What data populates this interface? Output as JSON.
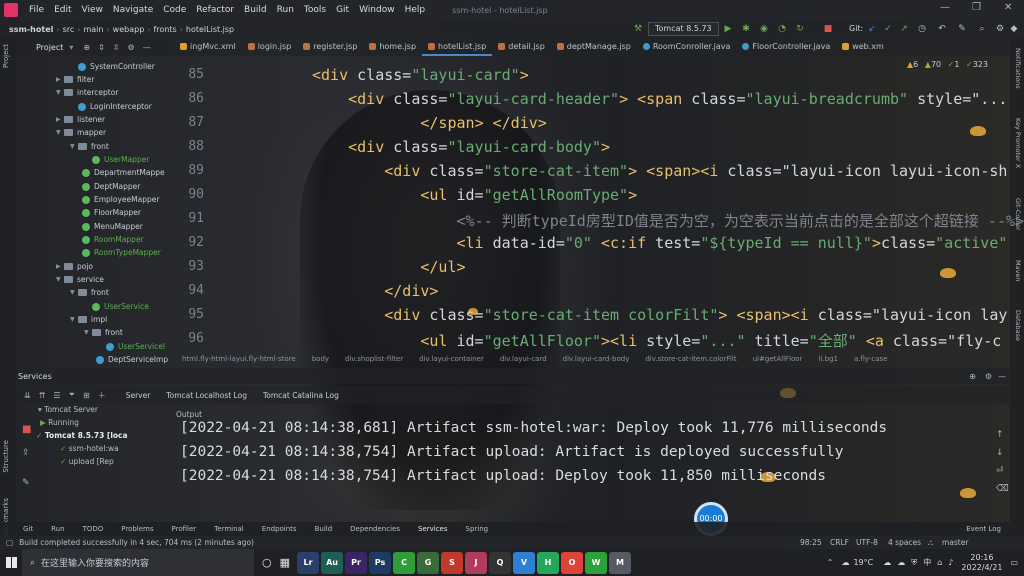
{
  "menubar": {
    "items": [
      "File",
      "Edit",
      "View",
      "Navigate",
      "Code",
      "Refactor",
      "Build",
      "Run",
      "Tools",
      "Git",
      "Window",
      "Help"
    ],
    "window_title": "ssm-hotel - hotelList.jsp"
  },
  "breadcrumb": [
    "ssm-hotel",
    "src",
    "main",
    "webapp",
    "fronts",
    "hotelList.jsp"
  ],
  "run_config": "Tomcat 8.5.73",
  "git_label": "Git:",
  "project_panel": {
    "title": "Project",
    "tree": [
      {
        "label": "SystemController",
        "kind": "class"
      },
      {
        "label": "filter",
        "kind": "folder"
      },
      {
        "label": "interceptor",
        "kind": "folder"
      },
      {
        "label": "LoginInterceptor",
        "kind": "class"
      },
      {
        "label": "listener",
        "kind": "folder"
      },
      {
        "label": "mapper",
        "kind": "folder"
      },
      {
        "label": "front",
        "kind": "folder"
      },
      {
        "label": "UserMapper",
        "kind": "iface-green"
      },
      {
        "label": "DepartmentMappe",
        "kind": "iface"
      },
      {
        "label": "DeptMapper",
        "kind": "iface"
      },
      {
        "label": "EmployeeMapper",
        "kind": "iface"
      },
      {
        "label": "FloorMapper",
        "kind": "iface"
      },
      {
        "label": "MenuMapper",
        "kind": "iface"
      },
      {
        "label": "RoomMapper",
        "kind": "iface-green"
      },
      {
        "label": "RoomTypeMapper",
        "kind": "iface-green"
      },
      {
        "label": "pojo",
        "kind": "folder"
      },
      {
        "label": "service",
        "kind": "folder"
      },
      {
        "label": "front",
        "kind": "folder"
      },
      {
        "label": "UserService",
        "kind": "iface-green"
      },
      {
        "label": "impl",
        "kind": "folder"
      },
      {
        "label": "front",
        "kind": "folder"
      },
      {
        "label": "UserServiceI",
        "kind": "class-green"
      },
      {
        "label": "DeptServiceImp",
        "kind": "class"
      }
    ]
  },
  "tabs": [
    {
      "label": "ingMvc.xml",
      "color": "#e0a030"
    },
    {
      "label": "login.jsp",
      "color": "#c07040"
    },
    {
      "label": "register.jsp",
      "color": "#c07040"
    },
    {
      "label": "home.jsp",
      "color": "#c07040"
    },
    {
      "label": "hotelList.jsp",
      "color": "#c07040"
    },
    {
      "label": "detail.jsp",
      "color": "#c07040"
    },
    {
      "label": "deptManage.jsp",
      "color": "#c07040"
    },
    {
      "label": "RoomConroller.java",
      "color": "#3e9cd1"
    },
    {
      "label": "FloorController.java",
      "color": "#3e9cd1"
    },
    {
      "label": "web.xm",
      "color": "#e0a030"
    }
  ],
  "inspections": {
    "warnings": "6",
    "weak": "70",
    "typos": "1",
    "other": "323"
  },
  "editor": {
    "line_numbers": [
      "85",
      "86",
      "87",
      "88",
      "89",
      "90",
      "91",
      "92",
      "93",
      "94",
      "95",
      "96"
    ],
    "lines": [
      "<div class=\"layui-card\">",
      "    <div class=\"layui-card-header\"> <span class=\"layui-breadcrumb\" style=\"...",
      "            </span> </div>",
      "    <div class=\"layui-card-body\">",
      "        <div class=\"store-cat-item\"> <span><i class=\"layui-icon layui-icon-sh",
      "            <ul id=\"getAllRoomType\">",
      "                <%-- 判断typeId房型ID值是否为空，为空表示当前点击的是全部这个超链接 --%>",
      "                <li data-id=\"0\" <c:if test=\"${typeId == null}\">class=\"active\"",
      "            </ul>",
      "        </div>",
      "        <div class=\"store-cat-item colorFilt\"> <span><i class=\"layui-icon lay",
      "            <ul id=\"getAllFloor\"><li style=\"...\" title=\"全部\" <a class=\"fly-c"
    ]
  },
  "html_crumbs": [
    "html.fly-html-layui.fly-html-store",
    "body",
    "div.shoplist-filter",
    "div.layui-container",
    "div.layui-card",
    "div.layui-card-body",
    "div.store-cat-item.colorFilt",
    "ul#getAllFloor",
    "li.bg1",
    "a.fly-case"
  ],
  "services": {
    "title": "Services",
    "tabs": [
      "Server",
      "Tomcat Localhost Log",
      "Tomcat Catalina Log"
    ],
    "output_label": "Output",
    "tree": [
      {
        "label": "Tomcat Server"
      },
      {
        "label": "Running"
      },
      {
        "label": "Tomcat 8.5.73 [loca"
      },
      {
        "label": "ssm-hotel:wa"
      },
      {
        "label": "upload [Rep"
      }
    ],
    "log": [
      "[2022-04-21 08:14:38,681] Artifact ssm-hotel:war: Deploy took 11,776 milliseconds",
      "[2022-04-21 08:14:38,754] Artifact upload: Artifact is deployed successfully",
      "[2022-04-21 08:14:38,754] Artifact upload: Deploy took 11,850 milliseconds"
    ]
  },
  "timer": "00:00",
  "toolwindows": [
    "Git",
    "Run",
    "TODO",
    "Problems",
    "Profiler",
    "Terminal",
    "Endpoints",
    "Build",
    "Dependencies",
    "Services",
    "Spring"
  ],
  "event_log": "Event Log",
  "status": {
    "message": "Build completed successfully in 4 sec, 704 ms (2 minutes ago)",
    "position": "98:25",
    "line_sep": "CRLF",
    "encoding": "UTF-8",
    "indent": "4 spaces",
    "branch": "master"
  },
  "taskbar": {
    "search_placeholder": "在这里输入你要搜索的内容",
    "apps": [
      {
        "label": "Lr",
        "color": "#2a3f6a"
      },
      {
        "label": "Au",
        "color": "#1f5e57"
      },
      {
        "label": "Pr",
        "color": "#3b2466"
      },
      {
        "label": "Ps",
        "color": "#1d3a63"
      },
      {
        "label": "C",
        "color": "#2f9e3a"
      },
      {
        "label": "G",
        "color": "#3a6a3a"
      },
      {
        "label": "S",
        "color": "#c0392b"
      },
      {
        "label": "J",
        "color": "#b23a5c"
      },
      {
        "label": "Q",
        "color": "#333333"
      },
      {
        "label": "V",
        "color": "#2f7fd4"
      },
      {
        "label": "H",
        "color": "#26a65b"
      },
      {
        "label": "O",
        "color": "#db4437"
      },
      {
        "label": "W",
        "color": "#2aa139"
      },
      {
        "label": "M",
        "color": "#555a63"
      }
    ],
    "weather": "19°C",
    "time": "20:16",
    "date": "2022/4/21"
  }
}
